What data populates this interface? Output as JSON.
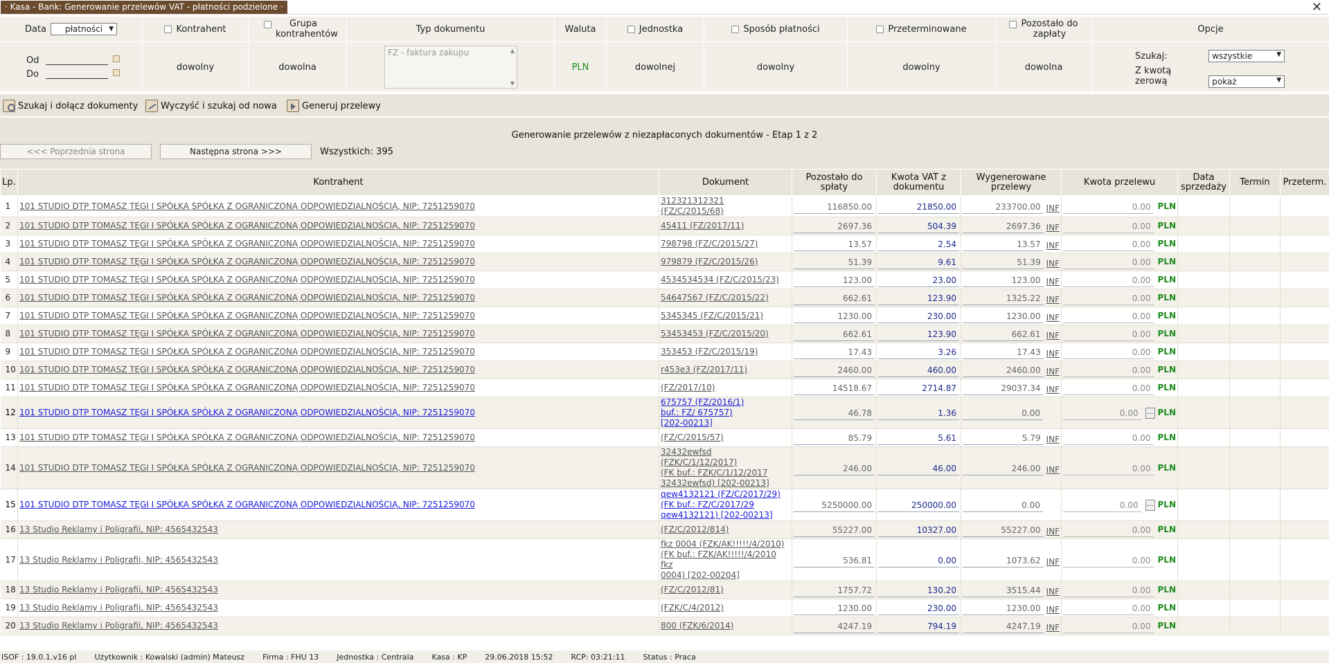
{
  "window": {
    "title": "· Kasa - Bank: Generowanie przelewów VAT - płatności podzielone ·",
    "close_glyph": "✕"
  },
  "filters": {
    "data_label": "Data",
    "data_select": "płatności",
    "od_label": "Od",
    "do_label": "Do",
    "kontrahent_label": "Kontrahent",
    "kontrahent_value": "dowolny",
    "grupa_label": "Grupa kontrahentów",
    "grupa_value": "dowolna",
    "typ_label": "Typ dokumentu",
    "typ_value": "FZ - faktura zakupu",
    "waluta_label": "Waluta",
    "waluta_value": "PLN",
    "jednostka_label": "Jednostka",
    "jednostka_value": "dowolnej",
    "sposob_label": "Sposób płatności",
    "sposob_value": "dowolny",
    "przeterm_label": "Przeterminowane",
    "przeterm_value": "dowolny",
    "pozostalo_label": "Pozostało do zapłaty",
    "pozostalo_value": "dowolna",
    "opcje_label": "Opcje",
    "szukaj_label": "Szukaj:",
    "szukaj_value": "wszystkie",
    "zerowa_label": "Z kwotą zerową",
    "zerowa_value": "pokaż"
  },
  "toolbar": {
    "search_attach": "Szukaj i dołącz dokumenty",
    "clear_search": "Wyczyść i szukaj od nowa",
    "generate": "Generuj przelewy"
  },
  "stage": {
    "title": "Generowanie przelewów z niezapłaconych dokumentów - Etap 1 z 2",
    "prev": "<<< Poprzednia strona",
    "next": "Następna strona >>>",
    "total": "Wszystkich: 395"
  },
  "table": {
    "headers": {
      "lp": "Lp.",
      "kontrahent": "Kontrahent",
      "dokument": "Dokument",
      "pozostalo": "Pozostało do spłaty",
      "kwota_vat": "Kwota VAT z dokumentu",
      "wygenerowane": "Wygenerowane przelewy",
      "kwota_przelewu": "Kwota przelewu",
      "data_sprzedazy": "Data sprzedaży",
      "termin": "Termin",
      "przeterm": "Przeterm."
    },
    "inf": "INF",
    "currency": "PLN",
    "dots": "...",
    "rows": [
      {
        "lp": "1",
        "k": "101 STUDIO DTP TOMASZ TĘGI I SPÓŁKA SPÓŁKA Z OGRANICZONĄ ODPOWIEDZIALNOŚCIĄ, NIP: 7251259070",
        "doc": [
          "312321312321",
          "(FZ/C/2015/68)"
        ],
        "poz": "116850.00",
        "vat": "21850.00",
        "gen": "233700.00",
        "kw": "0.00",
        "hl": false
      },
      {
        "lp": "2",
        "k": "101 STUDIO DTP TOMASZ TĘGI I SPÓŁKA SPÓŁKA Z OGRANICZONĄ ODPOWIEDZIALNOŚCIĄ, NIP: 7251259070",
        "doc": [
          "45411 (FZ/2017/11)"
        ],
        "poz": "2697.36",
        "vat": "504.39",
        "gen": "2697.36",
        "kw": "0.00",
        "hl": false
      },
      {
        "lp": "3",
        "k": "101 STUDIO DTP TOMASZ TĘGI I SPÓŁKA SPÓŁKA Z OGRANICZONĄ ODPOWIEDZIALNOŚCIĄ, NIP: 7251259070",
        "doc": [
          "798798 (FZ/C/2015/27)"
        ],
        "poz": "13.57",
        "vat": "2.54",
        "gen": "13.57",
        "kw": "0.00",
        "hl": false
      },
      {
        "lp": "4",
        "k": "101 STUDIO DTP TOMASZ TĘGI I SPÓŁKA SPÓŁKA Z OGRANICZONĄ ODPOWIEDZIALNOŚCIĄ, NIP: 7251259070",
        "doc": [
          "979879 (FZ/C/2015/26)"
        ],
        "poz": "51.39",
        "vat": "9.61",
        "gen": "51.39",
        "kw": "0.00",
        "hl": false
      },
      {
        "lp": "5",
        "k": "101 STUDIO DTP TOMASZ TĘGI I SPÓŁKA SPÓŁKA Z OGRANICZONĄ ODPOWIEDZIALNOŚCIĄ, NIP: 7251259070",
        "doc": [
          "4534534534 (FZ/C/2015/23)"
        ],
        "poz": "123.00",
        "vat": "23.00",
        "gen": "123.00",
        "kw": "0.00",
        "hl": false
      },
      {
        "lp": "6",
        "k": "101 STUDIO DTP TOMASZ TĘGI I SPÓŁKA SPÓŁKA Z OGRANICZONĄ ODPOWIEDZIALNOŚCIĄ, NIP: 7251259070",
        "doc": [
          "54647567 (FZ/C/2015/22)"
        ],
        "poz": "662.61",
        "vat": "123.90",
        "gen": "1325.22",
        "kw": "0.00",
        "hl": false
      },
      {
        "lp": "7",
        "k": "101 STUDIO DTP TOMASZ TĘGI I SPÓŁKA SPÓŁKA Z OGRANICZONĄ ODPOWIEDZIALNOŚCIĄ, NIP: 7251259070",
        "doc": [
          "5345345 (FZ/C/2015/21)"
        ],
        "poz": "1230.00",
        "vat": "230.00",
        "gen": "1230.00",
        "kw": "0.00",
        "hl": false
      },
      {
        "lp": "8",
        "k": "101 STUDIO DTP TOMASZ TĘGI I SPÓŁKA SPÓŁKA Z OGRANICZONĄ ODPOWIEDZIALNOŚCIĄ, NIP: 7251259070",
        "doc": [
          "53453453 (FZ/C/2015/20)"
        ],
        "poz": "662.61",
        "vat": "123.90",
        "gen": "662.61",
        "kw": "0.00",
        "hl": false
      },
      {
        "lp": "9",
        "k": "101 STUDIO DTP TOMASZ TĘGI I SPÓŁKA SPÓŁKA Z OGRANICZONĄ ODPOWIEDZIALNOŚCIĄ, NIP: 7251259070",
        "doc": [
          "353453 (FZ/C/2015/19)"
        ],
        "poz": "17.43",
        "vat": "3.26",
        "gen": "17.43",
        "kw": "0.00",
        "hl": false
      },
      {
        "lp": "10",
        "k": "101 STUDIO DTP TOMASZ TĘGI I SPÓŁKA SPÓŁKA Z OGRANICZONĄ ODPOWIEDZIALNOŚCIĄ, NIP: 7251259070",
        "doc": [
          "r453e3 (FZ/2017/11)"
        ],
        "poz": "2460.00",
        "vat": "460.00",
        "gen": "2460.00",
        "kw": "0.00",
        "hl": false
      },
      {
        "lp": "11",
        "k": "101 STUDIO DTP TOMASZ TĘGI I SPÓŁKA SPÓŁKA Z OGRANICZONĄ ODPOWIEDZIALNOŚCIĄ, NIP: 7251259070",
        "doc": [
          "(FZ/2017/10)"
        ],
        "poz": "14518.67",
        "vat": "2714.87",
        "gen": "29037.34",
        "kw": "0.00",
        "hl": false
      },
      {
        "lp": "12",
        "k": "101 STUDIO DTP TOMASZ TĘGI I SPÓŁKA SPÓŁKA Z OGRANICZONĄ ODPOWIEDZIALNOŚCIĄ, NIP: 7251259070",
        "doc": [
          "675757 (FZ/2016/1)",
          "buf.: FZ/ 675757)",
          "[202-00213]"
        ],
        "poz": "46.78",
        "vat": "1.36",
        "gen": "0.00",
        "kw": "0.00",
        "hl": true
      },
      {
        "lp": "13",
        "k": "101 STUDIO DTP TOMASZ TĘGI I SPÓŁKA SPÓŁKA Z OGRANICZONĄ ODPOWIEDZIALNOŚCIĄ, NIP: 7251259070",
        "doc": [
          "(FZ/C/2015/57)"
        ],
        "poz": "85.79",
        "vat": "5.61",
        "gen": "5.79",
        "kw": "0.00",
        "hl": false
      },
      {
        "lp": "14",
        "k": "101 STUDIO DTP TOMASZ TĘGI I SPÓŁKA SPÓŁKA Z OGRANICZONĄ ODPOWIEDZIALNOŚCIĄ, NIP: 7251259070",
        "doc": [
          "32432ewfsd (FZK/C/1/12/2017)",
          "(FK buf.: FZK/C/1/12/2017",
          "32432ewfsd) [202-00213]"
        ],
        "poz": "246.00",
        "vat": "46.00",
        "gen": "246.00",
        "kw": "0.00",
        "hl": false
      },
      {
        "lp": "15",
        "k": "101 STUDIO DTP TOMASZ TĘGI I SPÓŁKA SPÓŁKA Z OGRANICZONĄ ODPOWIEDZIALNOŚCIĄ, NIP: 7251259070",
        "doc": [
          "qew4132121 (FZ/C/2017/29)",
          "(FK buf.: FZ/C/2017/29",
          "qew4132121) [202-00213]"
        ],
        "poz": "5250000.00",
        "vat": "250000.00",
        "gen": "0.00",
        "kw": "0.00",
        "hl": true
      },
      {
        "lp": "16",
        "k": "13 Studio Reklamy i Poligrafii, NIP: 4565432543",
        "doc": [
          "(FZ/C/2012/814)"
        ],
        "poz": "55227.00",
        "vat": "10327.00",
        "gen": "55227.00",
        "kw": "0.00",
        "hl": false
      },
      {
        "lp": "17",
        "k": "13 Studio Reklamy i Poligrafii, NIP: 4565432543",
        "doc": [
          "fkz 0004 (FZK/AK!!!!!/4/2010)",
          "(FK buf.: FZK/AK!!!!!/4/2010 fkz",
          "0004) [202-00204]"
        ],
        "poz": "536.81",
        "vat": "0.00",
        "gen": "1073.62",
        "kw": "0.00",
        "hl": false
      },
      {
        "lp": "18",
        "k": "13 Studio Reklamy i Poligrafii, NIP: 4565432543",
        "doc": [
          "(FZ/C/2012/81)"
        ],
        "poz": "1757.72",
        "vat": "130.20",
        "gen": "3515.44",
        "kw": "0.00",
        "hl": false
      },
      {
        "lp": "19",
        "k": "13 Studio Reklamy i Poligrafii, NIP: 4565432543",
        "doc": [
          "(FZK/C/4/2012)"
        ],
        "poz": "1230.00",
        "vat": "230.00",
        "gen": "1230.00",
        "kw": "0.00",
        "hl": false
      },
      {
        "lp": "20",
        "k": "13 Studio Reklamy i Poligrafii, NIP: 4565432543",
        "doc": [
          "800 (FZK/6/2014)"
        ],
        "poz": "4247.19",
        "vat": "794.19",
        "gen": "4247.19",
        "kw": "0.00",
        "hl": false
      }
    ]
  },
  "status": {
    "isof": "ISOF : 19.0.1.v16 pl",
    "user": "Użytkownik : Kowalski (admin) Mateusz",
    "firma": "Firma : FHU 13",
    "jednostka": "Jednostka : Centrala",
    "kasa": "Kasa : KP",
    "datetime": "29.06.2018 15:52",
    "rcp": "RCP: 03:21:11",
    "status": "Status : Praca"
  }
}
